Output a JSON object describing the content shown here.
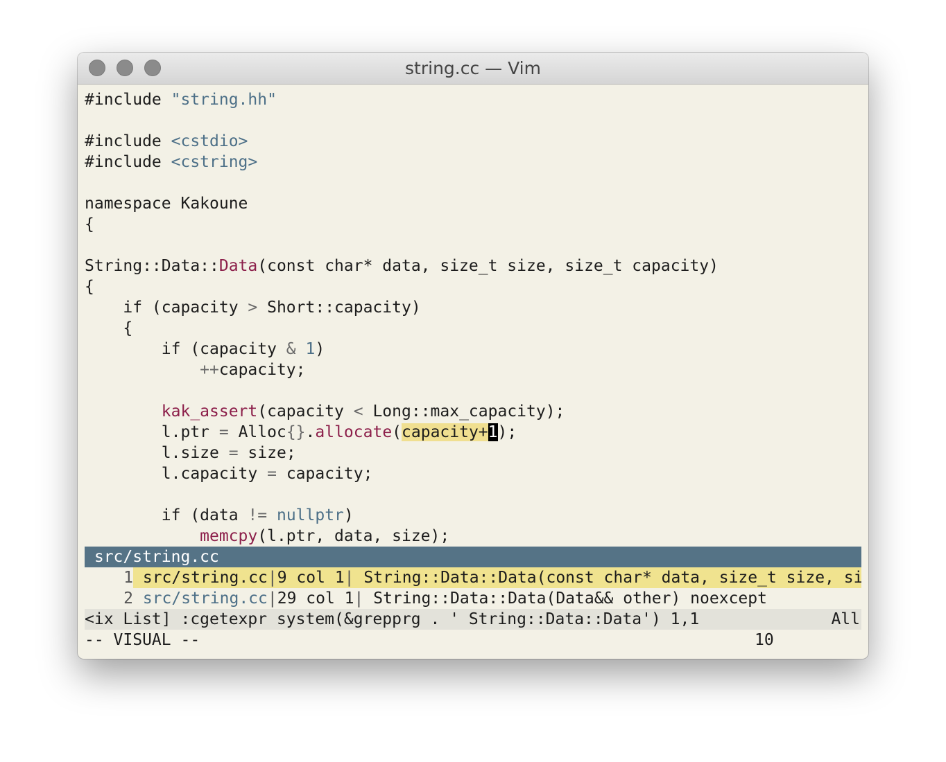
{
  "window": {
    "title": "string.cc — Vim"
  },
  "code": [
    [
      {
        "t": "#include "
      },
      {
        "t": "\"string.hh\"",
        "c": "str"
      }
    ],
    [],
    [
      {
        "t": "#include "
      },
      {
        "t": "<cstdio>",
        "c": "str"
      }
    ],
    [
      {
        "t": "#include "
      },
      {
        "t": "<cstring>",
        "c": "str"
      }
    ],
    [],
    [
      {
        "t": "namespace Kakoune"
      }
    ],
    [
      {
        "t": "{"
      }
    ],
    [],
    [
      {
        "t": "String::Data::"
      },
      {
        "t": "Data",
        "c": "fn"
      },
      {
        "t": "(const char* data, size_t size, size_t capacity)"
      }
    ],
    [
      {
        "t": "{"
      }
    ],
    [
      {
        "t": "    if (capacity "
      },
      {
        "t": ">",
        "c": "pun"
      },
      {
        "t": " Short::capacity)"
      }
    ],
    [
      {
        "t": "    {"
      }
    ],
    [
      {
        "t": "        if (capacity "
      },
      {
        "t": "&",
        "c": "pun"
      },
      {
        "t": " "
      },
      {
        "t": "1",
        "c": "num"
      },
      {
        "t": ")"
      }
    ],
    [
      {
        "t": "            "
      },
      {
        "t": "++",
        "c": "pun"
      },
      {
        "t": "capacity;"
      }
    ],
    [],
    [
      {
        "t": "        "
      },
      {
        "t": "kak_assert",
        "c": "fn"
      },
      {
        "t": "(capacity "
      },
      {
        "t": "<",
        "c": "pun"
      },
      {
        "t": " Long::max_capacity);"
      }
    ],
    [
      {
        "t": "        l.ptr "
      },
      {
        "t": "=",
        "c": "pun"
      },
      {
        "t": " Alloc"
      },
      {
        "t": "{}",
        "c": "pun"
      },
      {
        "t": "."
      },
      {
        "t": "allocate",
        "c": "fn"
      },
      {
        "t": "("
      },
      {
        "t": "capacity+",
        "c": "sel"
      },
      {
        "t": "1",
        "c": "cursor"
      },
      {
        "t": ");"
      }
    ],
    [
      {
        "t": "        l.size "
      },
      {
        "t": "=",
        "c": "pun"
      },
      {
        "t": " size;"
      }
    ],
    [
      {
        "t": "        l.capacity "
      },
      {
        "t": "=",
        "c": "pun"
      },
      {
        "t": " capacity;"
      }
    ],
    [],
    [
      {
        "t": "        if (data "
      },
      {
        "t": "!=",
        "c": "pun"
      },
      {
        "t": " "
      },
      {
        "t": "nullptr",
        "c": "str"
      },
      {
        "t": ")"
      }
    ],
    [
      {
        "t": "            "
      },
      {
        "t": "memcpy",
        "c": "fn"
      },
      {
        "t": "(l.ptr, data, size);"
      }
    ]
  ],
  "quickfix": {
    "title": " src/string.cc",
    "rows": [
      {
        "index": "1",
        "file": "src/string.cc",
        "loc": "9 col 1",
        "text": " String::Data::Data(const char* data, size_t size, si"
      },
      {
        "index": "2",
        "file": "src/string.cc",
        "loc": "29 col 1",
        "text": " String::Data::Data(Data&& other) noexcept"
      }
    ]
  },
  "statusline": {
    "left": "<ix List] :cgetexpr system(&grepprg . ' String::Data::Data') 1,1",
    "right": "All"
  },
  "cmdline": {
    "mode": "-- VISUAL --",
    "count": "10"
  },
  "colors": {
    "accent": "#557386",
    "selection": "#f0df90",
    "function": "#8c1f4a",
    "string": "#4c6f87"
  }
}
